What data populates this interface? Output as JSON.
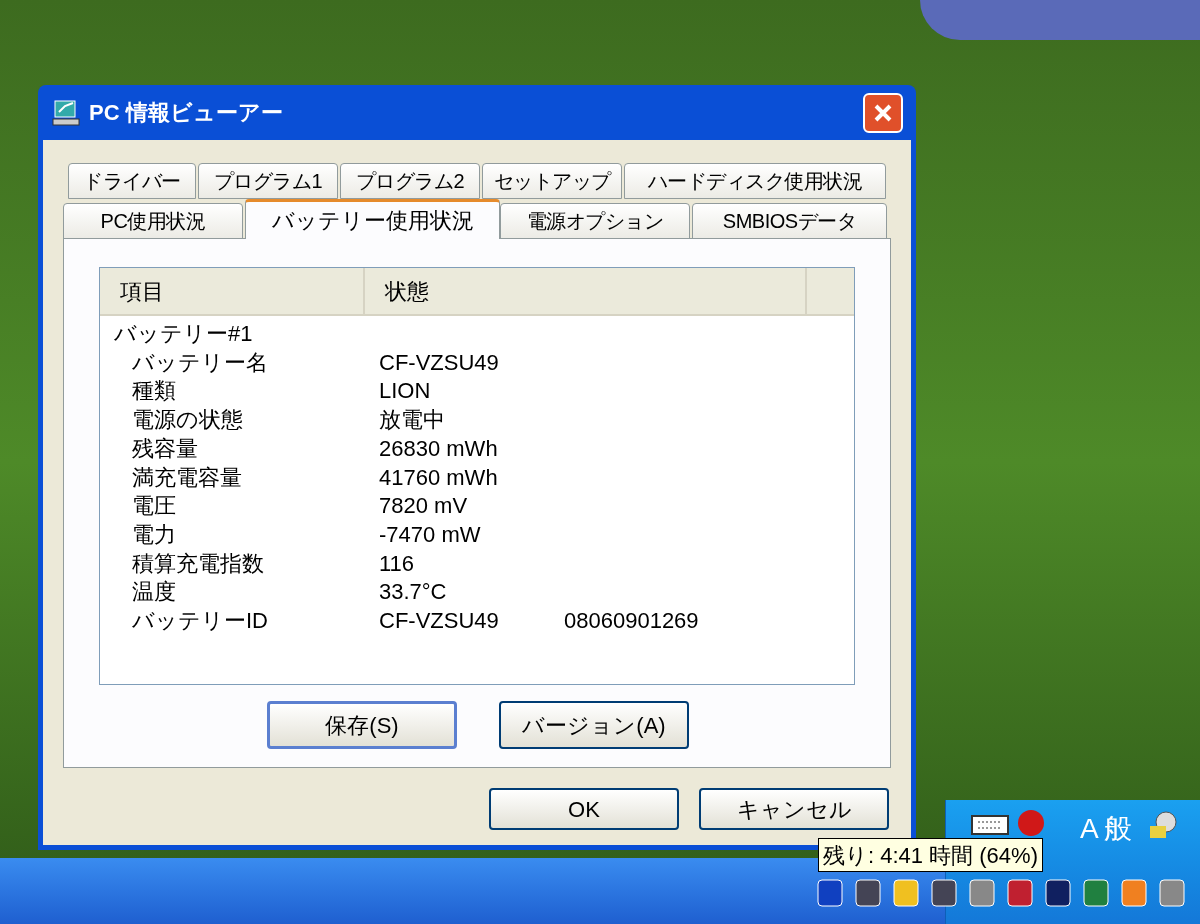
{
  "window": {
    "title": "PC 情報ビューアー"
  },
  "tabs": [
    [
      {
        "label": "ドライバー",
        "selected": false
      },
      {
        "label": "プログラム1",
        "selected": false
      },
      {
        "label": "プログラム2",
        "selected": false
      },
      {
        "label": "セットアップ",
        "selected": false
      },
      {
        "label": "ハードディスク使用状況",
        "selected": false
      }
    ],
    [
      {
        "label": "PC使用状況",
        "selected": false
      },
      {
        "label": "バッテリー使用状況",
        "selected": true
      },
      {
        "label": "電源オプション",
        "selected": false
      },
      {
        "label": "SMBIOSデータ",
        "selected": false
      }
    ]
  ],
  "list": {
    "columns": [
      "項目",
      "状態"
    ],
    "rows": [
      {
        "item": "バッテリー#1",
        "children": [
          {
            "item": "バッテリー名",
            "values": [
              "CF-VZSU49"
            ]
          },
          {
            "item": "種類",
            "values": [
              "LION"
            ]
          },
          {
            "item": "電源の状態",
            "values": [
              "放電中"
            ]
          },
          {
            "item": "残容量",
            "values": [
              "26830 mWh"
            ]
          },
          {
            "item": "満充電容量",
            "values": [
              "41760 mWh"
            ]
          },
          {
            "item": "電圧",
            "values": [
              "7820 mV"
            ]
          },
          {
            "item": "電力",
            "values": [
              "-7470 mW"
            ]
          },
          {
            "item": "積算充電指数",
            "values": [
              "116"
            ]
          },
          {
            "item": "温度",
            "values": [
              "33.7°C"
            ]
          },
          {
            "item": "バッテリーID",
            "values": [
              "CF-VZSU49",
              "08060901269"
            ]
          }
        ]
      }
    ]
  },
  "panel_buttons": [
    {
      "label": "保存(S)",
      "default": true
    },
    {
      "label": "バージョン(A)",
      "default": false
    }
  ],
  "dialog_buttons": [
    "OK",
    "キャンセル"
  ],
  "tray": {
    "ime_mode": "A",
    "ime_input": "般",
    "tooltip": "残り: 4:41 時間 (64%)"
  }
}
